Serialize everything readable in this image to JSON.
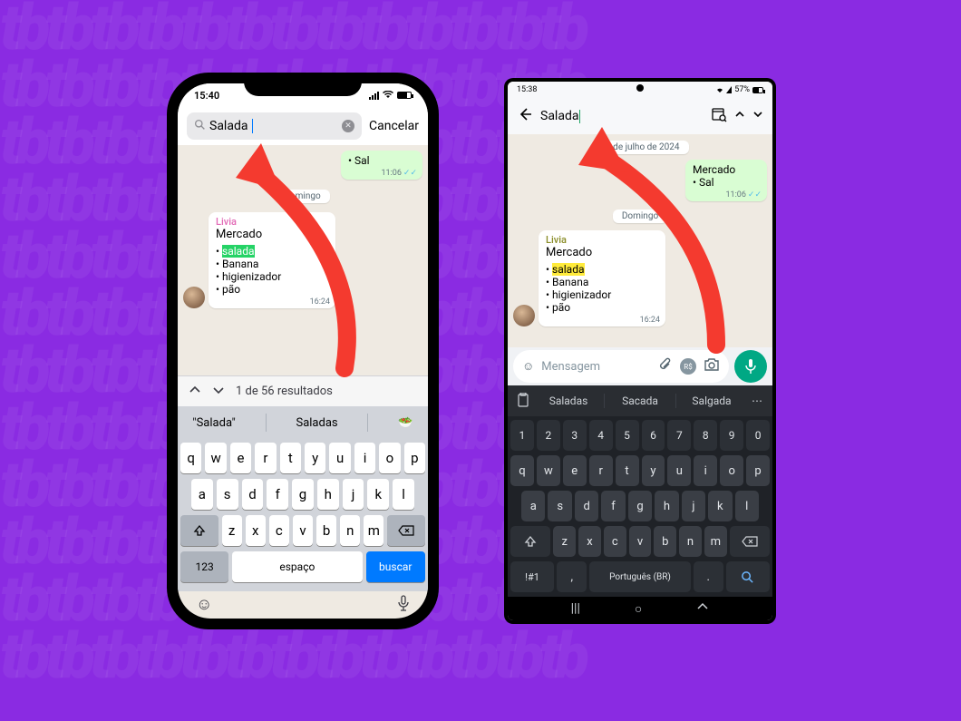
{
  "background_color": "#8a2be2",
  "ios": {
    "status_time": "15:40",
    "search_query": "Salada",
    "cancel_label": "Cancelar",
    "out_msg_line": "Sal",
    "out_msg_time": "11:06",
    "date_chip": "domingo",
    "in_sender": "Livia",
    "in_title": "Mercado",
    "in_items": {
      "i1": "salada",
      "i2": "Banana",
      "i3": "higienizador",
      "i4": "pão"
    },
    "in_time": "16:24",
    "results_text": "1 de 56 resultados",
    "suggestion_quoted": "\"Salada\"",
    "suggestion_plain": "Saladas",
    "suggestion_emoji": "🥗",
    "kb": {
      "r1": [
        "q",
        "w",
        "e",
        "r",
        "t",
        "y",
        "u",
        "i",
        "o",
        "p"
      ],
      "r2": [
        "a",
        "s",
        "d",
        "f",
        "g",
        "h",
        "j",
        "k",
        "l"
      ],
      "r3": [
        "z",
        "x",
        "c",
        "v",
        "b",
        "n",
        "m"
      ],
      "num_label": "123",
      "space_label": "espaço",
      "search_label": "buscar"
    }
  },
  "android": {
    "status_time": "15:38",
    "status_right": "57%",
    "search_query": "Salada",
    "date_chip": "23 de julho de 2024",
    "out_title": "Mercado",
    "out_line": "Sal",
    "out_time": "11:06",
    "day_chip": "Domingo",
    "in_sender": "Livia",
    "in_title": "Mercado",
    "in_items": {
      "i1": "salada",
      "i2": "Banana",
      "i3": "higienizador",
      "i4": "pão"
    },
    "in_time": "16:24",
    "input_placeholder": "Mensagem",
    "suggestions": {
      "s1": "Saladas",
      "s2": "Sacada",
      "s3": "Salgada"
    },
    "kb": {
      "nums": [
        "1",
        "2",
        "3",
        "4",
        "5",
        "6",
        "7",
        "8",
        "9",
        "0"
      ],
      "r1": [
        "q",
        "w",
        "e",
        "r",
        "t",
        "y",
        "u",
        "i",
        "o",
        "p"
      ],
      "r2": [
        "a",
        "s",
        "d",
        "f",
        "g",
        "h",
        "j",
        "k",
        "l"
      ],
      "r3": [
        "z",
        "x",
        "c",
        "v",
        "b",
        "n",
        "m"
      ],
      "sym_label": "!#1",
      "comma": ",",
      "space_label": "Português (BR)",
      "period": "."
    }
  }
}
